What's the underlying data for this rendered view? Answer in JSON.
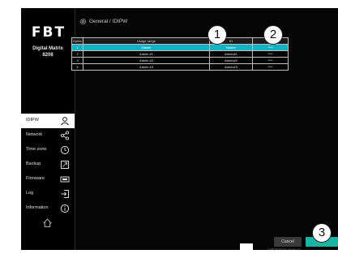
{
  "brand": {
    "logo": "FBT",
    "product_line1": "Digital Matrix",
    "product_line2": "8208"
  },
  "breadcrumb": "General / IDIPW",
  "sidebar": {
    "items": [
      {
        "label": "IDIPW",
        "icon": "user-icon",
        "active": true
      },
      {
        "label": "Network",
        "icon": "share-icon",
        "active": false
      },
      {
        "label": "Time zone",
        "icon": "clock-icon",
        "active": false
      },
      {
        "label": "Backup",
        "icon": "backup-icon",
        "active": false
      },
      {
        "label": "Firmware",
        "icon": "chip-icon",
        "active": false
      },
      {
        "label": "Log",
        "icon": "login-icon",
        "active": false
      },
      {
        "label": "Information",
        "icon": "info-icon",
        "active": false
      }
    ],
    "home_icon": "home-icon"
  },
  "table": {
    "headers": [
      "Option",
      "Usage range",
      "ID",
      "PW"
    ],
    "rows": [
      [
        "1",
        "Master",
        "Master",
        "****"
      ],
      [
        "2",
        "Admin #1",
        "Admin#1",
        "****"
      ],
      [
        "3",
        "Admin #2",
        "Admin#2",
        "****"
      ],
      [
        "4",
        "Admin #3",
        "Admin#3",
        "****"
      ]
    ],
    "selected_row": 0
  },
  "callouts": [
    "1",
    "2",
    "3"
  ],
  "buttons": {
    "cancel": "Cancel",
    "ok": "OK"
  },
  "footer": "© FBT Elettronica. Version 1.0",
  "colors": {
    "accent_teal": "#0fb3c4",
    "ok_green": "#1ab5a2",
    "background": "#050505"
  }
}
